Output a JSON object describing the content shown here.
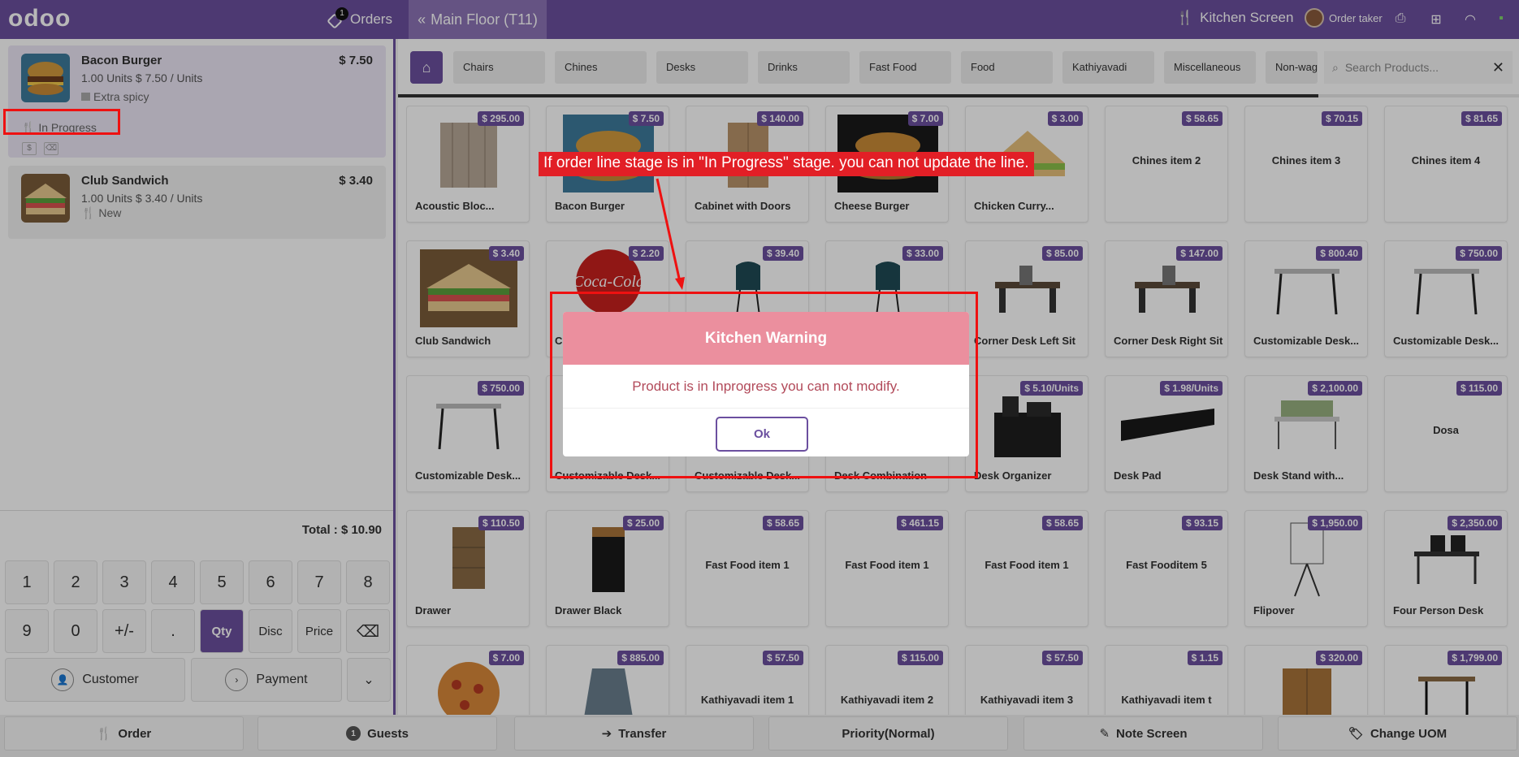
{
  "header": {
    "logo": "odoo",
    "orders_label": "Orders",
    "orders_badge": "1",
    "floor_label": "Main Floor (T11)",
    "kitchen_label": "Kitchen Screen",
    "user_label": "Order taker"
  },
  "order_lines": [
    {
      "name": "Bacon Burger",
      "price": "$ 7.50",
      "units": "1.00 Units $ 7.50 / Units",
      "note": "Extra spicy",
      "stage": "In Progress"
    },
    {
      "name": "Club Sandwich",
      "price": "$ 3.40",
      "units": "1.00 Units $ 3.40 / Units",
      "stage": "New"
    }
  ],
  "total": "Total : $ 10.90",
  "numpad": {
    "row1": [
      "1",
      "2",
      "3",
      "4",
      "5",
      "6",
      "7",
      "8"
    ],
    "row2": [
      "9",
      "0",
      "+/-",
      ".",
      "Qty",
      "Disc",
      "Price"
    ],
    "customer": "Customer",
    "payment": "Payment"
  },
  "categories": [
    "Chairs",
    "Chines",
    "Desks",
    "Drinks",
    "Fast Food",
    "Food",
    "Kathiyavadi",
    "Miscellaneous",
    "Non-wage"
  ],
  "search_placeholder": "Search Products...",
  "products": [
    {
      "name": "Acoustic Bloc...",
      "price": "$ 295.00"
    },
    {
      "name": "Bacon Burger",
      "price": "$ 7.50"
    },
    {
      "name": "Cabinet with Doors",
      "price": "$ 140.00"
    },
    {
      "name": "Cheese Burger",
      "price": "$ 7.00"
    },
    {
      "name": "Chicken Curry...",
      "price": "$ 3.00"
    },
    {
      "name": "Chines item 2",
      "price": "$ 58.65"
    },
    {
      "name": "Chines item 3",
      "price": "$ 70.15"
    },
    {
      "name": "Chines item 4",
      "price": "$ 81.65"
    },
    {
      "name": "Club Sandwich",
      "price": "$ 3.40"
    },
    {
      "name": "C",
      "price": "$ 2.20"
    },
    {
      "name": "",
      "price": "$ 39.40"
    },
    {
      "name": "",
      "price": "$ 33.00"
    },
    {
      "name": "Corner Desk Left Sit",
      "price": "$ 85.00"
    },
    {
      "name": "Corner Desk Right Sit",
      "price": "$ 147.00"
    },
    {
      "name": "Customizable Desk...",
      "price": "$ 800.40"
    },
    {
      "name": "Customizable Desk...",
      "price": "$ 750.00"
    },
    {
      "name": "Customizable Desk...",
      "price": "$ 750.00"
    },
    {
      "name": "Customizable Desk...",
      "price": ""
    },
    {
      "name": "Customizable Desk...",
      "price": ""
    },
    {
      "name": "Desk Combination",
      "price": ""
    },
    {
      "name": "Desk Organizer",
      "price": "$ 5.10/Units"
    },
    {
      "name": "Desk Pad",
      "price": "$ 1.98/Units"
    },
    {
      "name": "Desk Stand with...",
      "price": "$ 2,100.00"
    },
    {
      "name": "Dosa",
      "price": "$ 115.00"
    },
    {
      "name": "Drawer",
      "price": "$ 110.50"
    },
    {
      "name": "Drawer Black",
      "price": "$ 25.00"
    },
    {
      "name": "Fast Food item 1",
      "price": "$ 58.65"
    },
    {
      "name": "Fast Food item 1",
      "price": "$ 461.15"
    },
    {
      "name": "Fast Food item 1",
      "price": "$ 58.65"
    },
    {
      "name": "Fast Fooditem 5",
      "price": "$ 93.15"
    },
    {
      "name": "Flipover",
      "price": "$ 1,950.00"
    },
    {
      "name": "Four Person Desk",
      "price": "$ 2,350.00"
    },
    {
      "name": "",
      "price": "$ 7.00"
    },
    {
      "name": "",
      "price": "$ 885.00"
    },
    {
      "name": "Kathiyavadi item 1",
      "price": "$ 57.50"
    },
    {
      "name": "Kathiyavadi item 2",
      "price": "$ 115.00"
    },
    {
      "name": "Kathiyavadi item 3",
      "price": "$ 57.50"
    },
    {
      "name": "Kathiyavadi item t",
      "price": "$ 1.15"
    },
    {
      "name": "",
      "price": "$ 320.00"
    },
    {
      "name": "",
      "price": "$ 1,799.00"
    }
  ],
  "footer": [
    "Order",
    "Guests",
    "Transfer",
    "Priority(Normal)",
    "Note Screen",
    "Change UOM"
  ],
  "guests_badge": "1",
  "modal": {
    "title": "Kitchen Warning",
    "message": "Product is in Inprogress you can not modify.",
    "ok": "Ok"
  },
  "annotation": "If order line stage is in \"In Progress\" stage. you can not update the line.",
  "colors": {
    "brand": "#6b4f9f",
    "warning": "#eb8f9e",
    "annotation": "#e21f26"
  }
}
